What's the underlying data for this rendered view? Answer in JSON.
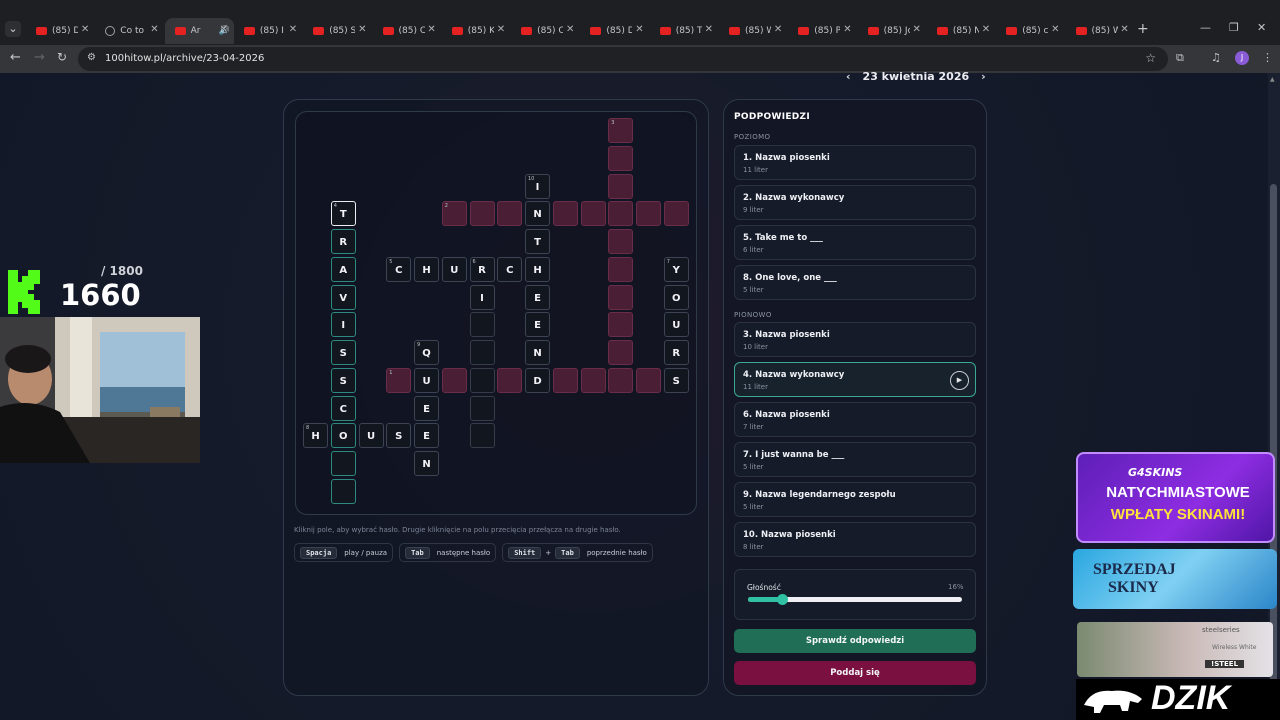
{
  "browser": {
    "tabs": [
      {
        "title": "(85) D"
      },
      {
        "title": "Co to"
      },
      {
        "title": "Ar"
      },
      {
        "title": "(85) I"
      },
      {
        "title": "(85) S"
      },
      {
        "title": "(85) C"
      },
      {
        "title": "(85) K"
      },
      {
        "title": "(85) C"
      },
      {
        "title": "(85) D"
      },
      {
        "title": "(85) T"
      },
      {
        "title": "(85) W"
      },
      {
        "title": "(85) P"
      },
      {
        "title": "(85) Jo"
      },
      {
        "title": "(85) N"
      },
      {
        "title": "(85) c"
      },
      {
        "title": "(85) W"
      }
    ],
    "active_tab_index": 2,
    "url": "100hitow.pl/archive/23-04-2026",
    "profile_initial": "J"
  },
  "header": {
    "date": "23 kwietnia 2026",
    "prev": "‹",
    "next": "›"
  },
  "crossword": {
    "cells": [
      {
        "col": 11,
        "row": 0,
        "type": "pink",
        "num": "3"
      },
      {
        "col": 11,
        "row": 1,
        "type": "pink"
      },
      {
        "col": 11,
        "row": 2,
        "type": "pink"
      },
      {
        "col": 8,
        "row": 2,
        "type": "ltr",
        "ch": "I",
        "num": "10"
      },
      {
        "col": 1,
        "row": 3,
        "type": "sel",
        "ch": "T",
        "num": "4"
      },
      {
        "col": 5,
        "row": 3,
        "type": "pink",
        "num": "2"
      },
      {
        "col": 6,
        "row": 3,
        "type": "pink"
      },
      {
        "col": 7,
        "row": 3,
        "type": "pink"
      },
      {
        "col": 8,
        "row": 3,
        "type": "ltr",
        "ch": "N"
      },
      {
        "col": 9,
        "row": 3,
        "type": "pink"
      },
      {
        "col": 10,
        "row": 3,
        "type": "pink"
      },
      {
        "col": 11,
        "row": 3,
        "type": "pink"
      },
      {
        "col": 12,
        "row": 3,
        "type": "pink"
      },
      {
        "col": 13,
        "row": 3,
        "type": "pink"
      },
      {
        "col": 1,
        "row": 4,
        "type": "teal",
        "ch": "R"
      },
      {
        "col": 8,
        "row": 4,
        "type": "ltr",
        "ch": "T"
      },
      {
        "col": 11,
        "row": 4,
        "type": "pink"
      },
      {
        "col": 1,
        "row": 5,
        "type": "teal",
        "ch": "A"
      },
      {
        "col": 3,
        "row": 5,
        "type": "ltr",
        "ch": "C",
        "num": "5"
      },
      {
        "col": 4,
        "row": 5,
        "type": "ltr",
        "ch": "H"
      },
      {
        "col": 5,
        "row": 5,
        "type": "ltr",
        "ch": "U"
      },
      {
        "col": 6,
        "row": 5,
        "type": "ltr",
        "ch": "R",
        "num": "6"
      },
      {
        "col": 7,
        "row": 5,
        "type": "ltr",
        "ch": "C"
      },
      {
        "col": 8,
        "row": 5,
        "type": "ltr",
        "ch": "H"
      },
      {
        "col": 11,
        "row": 5,
        "type": "pink"
      },
      {
        "col": 13,
        "row": 5,
        "type": "ltr",
        "ch": "Y",
        "num": "7"
      },
      {
        "col": 1,
        "row": 6,
        "type": "teal",
        "ch": "V"
      },
      {
        "col": 6,
        "row": 6,
        "type": "ltr",
        "ch": "I"
      },
      {
        "col": 8,
        "row": 6,
        "type": "ltr",
        "ch": "E"
      },
      {
        "col": 11,
        "row": 6,
        "type": "pink"
      },
      {
        "col": 13,
        "row": 6,
        "type": "ltr",
        "ch": "O"
      },
      {
        "col": 1,
        "row": 7,
        "type": "teal",
        "ch": "I"
      },
      {
        "col": 6,
        "row": 7,
        "type": "empty"
      },
      {
        "col": 8,
        "row": 7,
        "type": "ltr",
        "ch": "E"
      },
      {
        "col": 11,
        "row": 7,
        "type": "pink"
      },
      {
        "col": 13,
        "row": 7,
        "type": "ltr",
        "ch": "U"
      },
      {
        "col": 1,
        "row": 8,
        "type": "teal",
        "ch": "S"
      },
      {
        "col": 4,
        "row": 8,
        "type": "ltr",
        "ch": "Q",
        "num": "9"
      },
      {
        "col": 6,
        "row": 8,
        "type": "empty"
      },
      {
        "col": 8,
        "row": 8,
        "type": "ltr",
        "ch": "N"
      },
      {
        "col": 11,
        "row": 8,
        "type": "pink"
      },
      {
        "col": 13,
        "row": 8,
        "type": "ltr",
        "ch": "R"
      },
      {
        "col": 1,
        "row": 9,
        "type": "teal",
        "ch": "S"
      },
      {
        "col": 3,
        "row": 9,
        "type": "pink",
        "num": "1"
      },
      {
        "col": 4,
        "row": 9,
        "type": "ltr",
        "ch": "U"
      },
      {
        "col": 5,
        "row": 9,
        "type": "pink"
      },
      {
        "col": 6,
        "row": 9,
        "type": "empty"
      },
      {
        "col": 7,
        "row": 9,
        "type": "pink"
      },
      {
        "col": 8,
        "row": 9,
        "type": "ltr",
        "ch": "D"
      },
      {
        "col": 9,
        "row": 9,
        "type": "pink"
      },
      {
        "col": 10,
        "row": 9,
        "type": "pink"
      },
      {
        "col": 11,
        "row": 9,
        "type": "pink"
      },
      {
        "col": 12,
        "row": 9,
        "type": "pink"
      },
      {
        "col": 13,
        "row": 9,
        "type": "ltr",
        "ch": "S"
      },
      {
        "col": 1,
        "row": 10,
        "type": "teal",
        "ch": "C"
      },
      {
        "col": 4,
        "row": 10,
        "type": "ltr",
        "ch": "E"
      },
      {
        "col": 6,
        "row": 10,
        "type": "empty"
      },
      {
        "col": 0,
        "row": 11,
        "type": "ltr",
        "ch": "H",
        "num": "8"
      },
      {
        "col": 1,
        "row": 11,
        "type": "teal",
        "ch": "O"
      },
      {
        "col": 2,
        "row": 11,
        "type": "ltr",
        "ch": "U"
      },
      {
        "col": 3,
        "row": 11,
        "type": "ltr",
        "ch": "S"
      },
      {
        "col": 4,
        "row": 11,
        "type": "ltr",
        "ch": "E"
      },
      {
        "col": 6,
        "row": 11,
        "type": "empty"
      },
      {
        "col": 1,
        "row": 12,
        "type": "teal"
      },
      {
        "col": 4,
        "row": 12,
        "type": "ltr",
        "ch": "N"
      },
      {
        "col": 1,
        "row": 13,
        "type": "teal"
      }
    ],
    "hint": "Kliknij pole, aby wybrać hasło. Drugie kliknięcie na polu przecięcia przełącza na drugie hasło.",
    "shortcuts": [
      {
        "keys": [
          "Spacja"
        ],
        "label": "play / pauza"
      },
      {
        "keys": [
          "Tab"
        ],
        "label": "następne hasło"
      },
      {
        "keys": [
          "Shift",
          "Tab"
        ],
        "label": "poprzednie hasło",
        "joiner": "+"
      }
    ]
  },
  "clues": {
    "title": "PODPOWIEDZI",
    "across_label": "POZIOMO",
    "down_label": "PIONOWO",
    "across": [
      {
        "text": "1. Nazwa piosenki",
        "sub": "11 liter"
      },
      {
        "text": "2. Nazwa wykonawcy",
        "sub": "9 liter"
      },
      {
        "text": "5. Take me to ___",
        "sub": "6 liter"
      },
      {
        "text": "8. One love, one ___",
        "sub": "5 liter"
      }
    ],
    "down": [
      {
        "text": "3. Nazwa piosenki",
        "sub": "10 liter"
      },
      {
        "text": "4. Nazwa wykonawcy",
        "sub": "11 liter",
        "active": true
      },
      {
        "text": "6. Nazwa piosenki",
        "sub": "7 liter"
      },
      {
        "text": "7. I just wanna be ___",
        "sub": "5 liter"
      },
      {
        "text": "9. Nazwa legendarnego zespołu",
        "sub": "5 liter"
      },
      {
        "text": "10. Nazwa piosenki",
        "sub": "8 liter"
      }
    ],
    "play_icon": "▶",
    "volume_label": "Głośność",
    "volume_value": "16%",
    "volume_fraction": 0.16,
    "check_button": "Sprawdź odpowiedzi",
    "giveup_button": "Poddaj się"
  },
  "overlay": {
    "score": "1660",
    "max": "/ 1800",
    "ad1_brand": "G4SKINS",
    "ad1_line1": "NATYCHMIASTOWE",
    "ad1_line2": "WPŁATY SKINAMI!",
    "ad2_line1": "SPRZEDAJ",
    "ad2_line2": "SKINY",
    "ad3_brand": "steelseries",
    "ad3_product": "Wireless White",
    "ad3_code": "!STEEL",
    "ad4_brand": "DZIK"
  }
}
